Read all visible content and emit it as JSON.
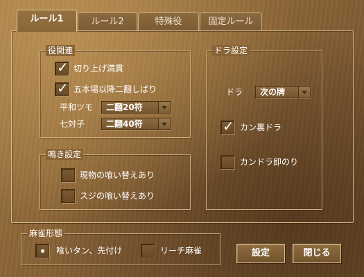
{
  "tabs": [
    {
      "label": "ルール1",
      "active": true
    },
    {
      "label": "ルール2",
      "active": false
    },
    {
      "label": "特殊役",
      "active": false
    },
    {
      "label": "固定ルール",
      "active": false
    }
  ],
  "yaku_group": {
    "title": "役関連",
    "kiriage_mangan": {
      "label": "切り上げ満貫",
      "checked": true
    },
    "honba_nihan": {
      "label": "五本場以降二翻しばり",
      "checked": true
    },
    "pinfu_tsumo": {
      "label": "平和ツモ",
      "value": "二翻20符"
    },
    "chiitoitsu": {
      "label": "七対子",
      "value": "二翻40符"
    }
  },
  "naki_group": {
    "title": "鳴き設定",
    "genbutsu": {
      "label": "現物の喰い替えあり",
      "checked": false
    },
    "suji": {
      "label": "スジの喰い替えあり",
      "checked": false
    }
  },
  "dora_group": {
    "title": "ドラ設定",
    "dora": {
      "label": "ドラ",
      "value": "次の牌"
    },
    "kan_ura": {
      "label": "カン裏ドラ",
      "checked": true
    },
    "kan_dora_soku": {
      "label": "カンドラ即のり",
      "checked": false
    }
  },
  "mahjong_form": {
    "title": "麻雀形態",
    "kuitan": {
      "label": "喰いタン、先付け",
      "selected": true
    },
    "riichi": {
      "label": "リーチ麻雀",
      "selected": false
    }
  },
  "buttons": {
    "settings": "設定",
    "close": "閉じる"
  },
  "colors": {
    "wood_light": "#a37c49",
    "wood_dark": "#6d4c2a",
    "border_light": "#d8bd8c",
    "text": "#ffffff"
  }
}
